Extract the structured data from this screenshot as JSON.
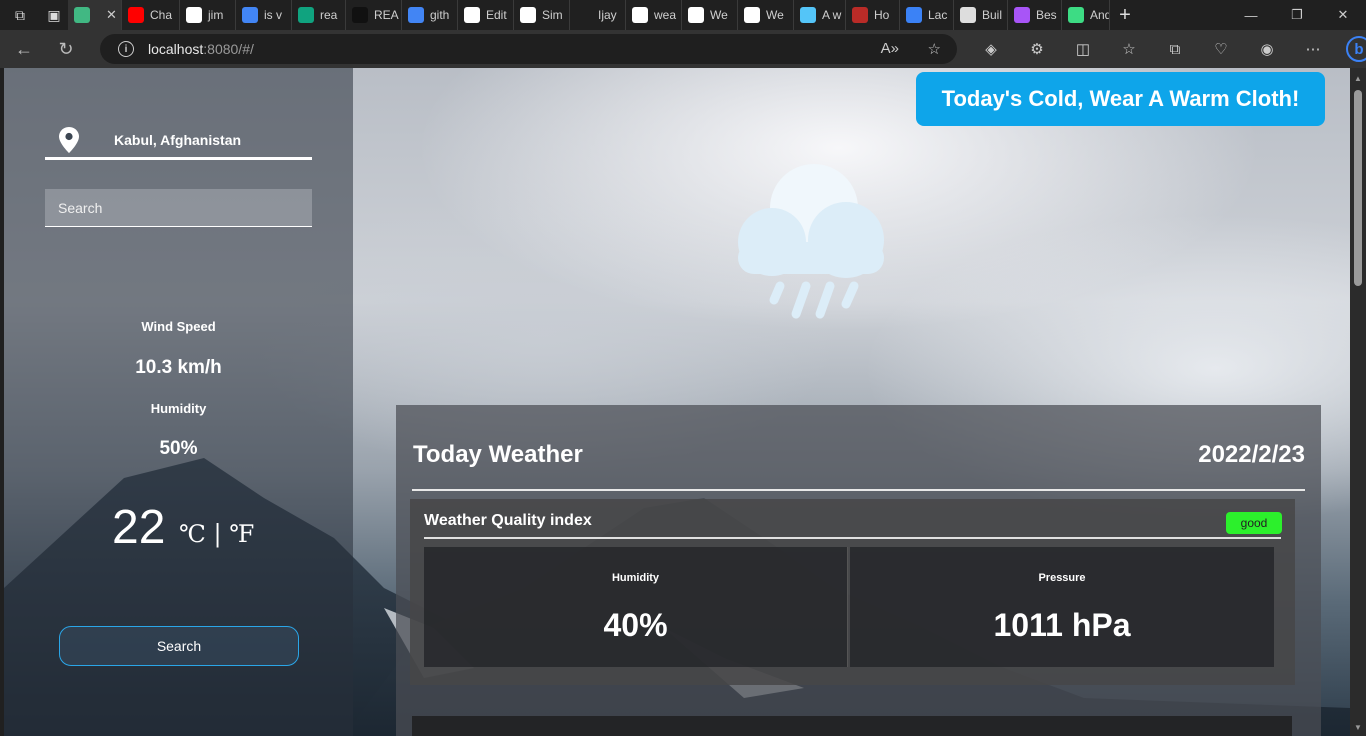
{
  "browser": {
    "tabs": [
      {
        "label": "",
        "icon": "vue-icon",
        "color": "#41b883",
        "active": true
      },
      {
        "label": "Cha",
        "icon": "youtube-icon",
        "color": "#ff0000"
      },
      {
        "label": "jim",
        "icon": "github-icon",
        "color": "#ffffff"
      },
      {
        "label": "is v",
        "icon": "google-icon",
        "color": "#4285f4"
      },
      {
        "label": "rea",
        "icon": "chatgpt-icon",
        "color": "#10a37f"
      },
      {
        "label": "REA",
        "icon": "app-icon",
        "color": "#111111"
      },
      {
        "label": "gith",
        "icon": "google-icon",
        "color": "#4285f4"
      },
      {
        "label": "Edit",
        "icon": "github-icon",
        "color": "#ffffff"
      },
      {
        "label": "Sim",
        "icon": "github-icon",
        "color": "#ffffff"
      },
      {
        "label": "Ijay",
        "icon": "page-icon",
        "color": "#202020"
      },
      {
        "label": "wea",
        "icon": "github-icon",
        "color": "#ffffff"
      },
      {
        "label": "We",
        "icon": "github-icon",
        "color": "#ffffff"
      },
      {
        "label": "We",
        "icon": "github-icon",
        "color": "#ffffff"
      },
      {
        "label": "A w",
        "icon": "flutter-icon",
        "color": "#54c5f8"
      },
      {
        "label": "Ho",
        "icon": "quora-icon",
        "color": "#b92b27"
      },
      {
        "label": "Lac",
        "icon": "drop-icon",
        "color": "#3b82f6"
      },
      {
        "label": "Buil",
        "icon": "build-icon",
        "color": "#dddddd"
      },
      {
        "label": "Bes",
        "icon": "feather-icon",
        "color": "#a855f7"
      },
      {
        "label": "And",
        "icon": "android-icon",
        "color": "#3ddc84"
      }
    ],
    "address": {
      "host": "localhost",
      "path": ":8080/#/"
    }
  },
  "sidebar": {
    "location": "Kabul, Afghanistan",
    "search_placeholder": "Search",
    "wind_label": "Wind Speed",
    "wind_value": "10.3 km/h",
    "humidity_label": "Humidity",
    "humidity_value": "50%",
    "temperature": "22",
    "units": "℃ | ℉",
    "search_button": "Search"
  },
  "main": {
    "banner": "Today's Cold, Wear A Warm Cloth!",
    "weather_icon": "rain-cloud-icon",
    "panel_title": "Today Weather",
    "date": "2022/2/23",
    "quality_title": "Weather Quality index",
    "quality_badge": "good",
    "metrics": [
      {
        "label": "Humidity",
        "value": "40%"
      },
      {
        "label": "Pressure",
        "value": "1011 hPa"
      }
    ]
  },
  "colors": {
    "banner": "#0ea5ea",
    "badge": "#2cf02c",
    "button_border": "#2aa6e8"
  }
}
